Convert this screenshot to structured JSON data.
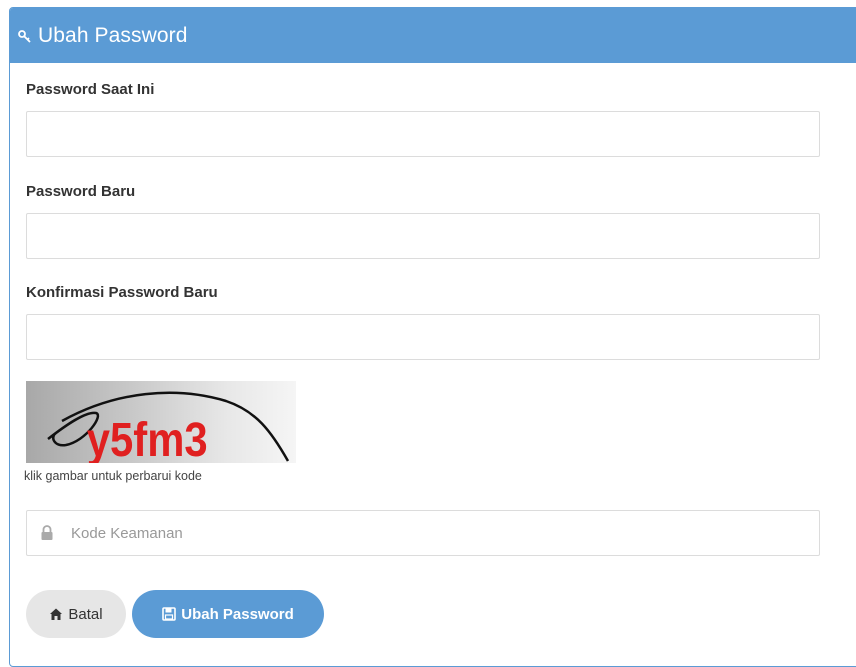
{
  "panel": {
    "title": "Ubah Password",
    "accent_color": "#5b9bd5",
    "header_icon": "key-icon"
  },
  "fields": {
    "current_password": {
      "label": "Password Saat Ini",
      "value": ""
    },
    "new_password": {
      "label": "Password Baru",
      "value": ""
    },
    "confirm_password": {
      "label": "Konfirmasi Password Baru",
      "value": ""
    }
  },
  "captcha": {
    "image_text": "y5fm3",
    "hint": "klik gambar untuk perbarui kode"
  },
  "security_code": {
    "placeholder": "Kode Keamanan",
    "value": "",
    "icon": "lock-icon"
  },
  "buttons": {
    "cancel": {
      "label": "Batal",
      "icon": "home-icon"
    },
    "submit": {
      "label": "Ubah Password",
      "icon": "save-icon"
    }
  }
}
